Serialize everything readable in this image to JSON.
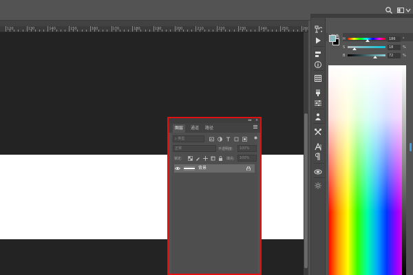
{
  "topbar": {
    "icons": [
      "search-icon",
      "workspace-switcher-icon",
      "chevron-down-icon"
    ]
  },
  "ruler": {
    "labels": [
      "120",
      "130",
      "140",
      "150",
      "160",
      "170",
      "180",
      "190",
      "200",
      "210",
      "220",
      "230",
      "240",
      "250",
      "260",
      "270"
    ]
  },
  "tools": {
    "icons": [
      "history-brush-icon",
      "play-actions-icon",
      "paragraph-styles-icon",
      "info-icon",
      "grid-icon",
      "brush-presets-icon",
      "adjustments-icon",
      "character-person-icon",
      "tools-preset-icon",
      "text-type-icon",
      "paragraph-icon",
      "layers-comps-icon",
      "settings-icon"
    ]
  },
  "color_panel": {
    "tab_label": "颜色",
    "foreground_color": "#8ab7bd",
    "background_color": "#000000",
    "sliders": [
      {
        "label": "H",
        "value": "186",
        "unit": "°",
        "fraction": 0.52
      },
      {
        "label": "S",
        "value": "18",
        "unit": "%",
        "fraction": 0.18
      },
      {
        "label": "B",
        "value": "72",
        "unit": "%",
        "fraction": 0.72
      }
    ]
  },
  "layers_panel": {
    "tabs": [
      {
        "label": "图层",
        "active": true
      },
      {
        "label": "通道",
        "active": false
      },
      {
        "label": "路径",
        "active": false
      }
    ],
    "search_placeholder": "类型",
    "blend_mode": "正常",
    "opacity_label": "不透明度:",
    "opacity_value": "100%",
    "lock_label": "锁定:",
    "fill_label": "填充:",
    "fill_value": "100%",
    "layers": [
      {
        "name": "背景",
        "visible": true,
        "locked": true
      }
    ],
    "accent_border": "#e01010"
  }
}
